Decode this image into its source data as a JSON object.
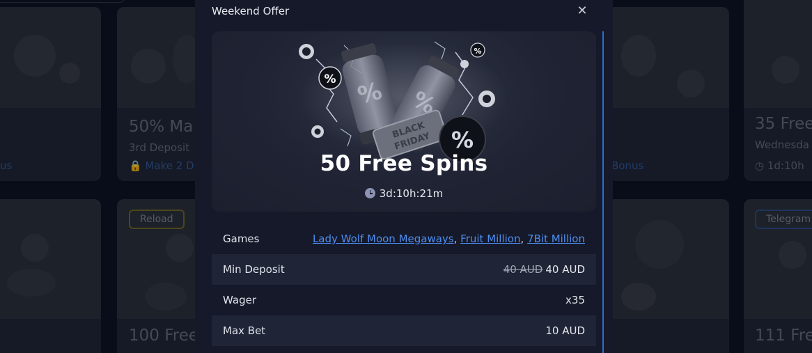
{
  "background": {
    "cards": [
      {
        "title": "50% Ma",
        "sub": "3rd Deposit",
        "link": "Make 2 D"
      },
      {
        "title": "35 Free",
        "sub": "Wednesda",
        "meta": "1d:10h"
      },
      {
        "title": "100 Free"
      },
      {
        "title": "111 Free"
      }
    ],
    "left_link_fragment": "us",
    "right_link_fragment": "Bonus",
    "badges": {
      "reload": "Reload",
      "telegram": "Telegram"
    }
  },
  "modal": {
    "title": "Weekend Offer",
    "close_icon": "close-icon",
    "hero": {
      "headline": "50 Free Spins",
      "timer": "3d:10h:21m",
      "tag_text_1": "BLACK",
      "tag_text_2": "FRIDAY"
    },
    "details": {
      "games_label": "Games",
      "games": [
        "Lady Wolf Moon Megaways",
        "Fruit Million",
        "7Bit Million"
      ],
      "games_separator": ", ",
      "min_deposit_label": "Min Deposit",
      "min_deposit_old": "40 AUD",
      "min_deposit_new": "40 AUD",
      "wager_label": "Wager",
      "wager_value": "x35",
      "max_bet_label": "Max Bet",
      "max_bet_value": "10 AUD"
    },
    "colors": {
      "link": "#4f8df0",
      "scrollbar": "#2f6fd0",
      "modal_bg": "#151929"
    }
  }
}
